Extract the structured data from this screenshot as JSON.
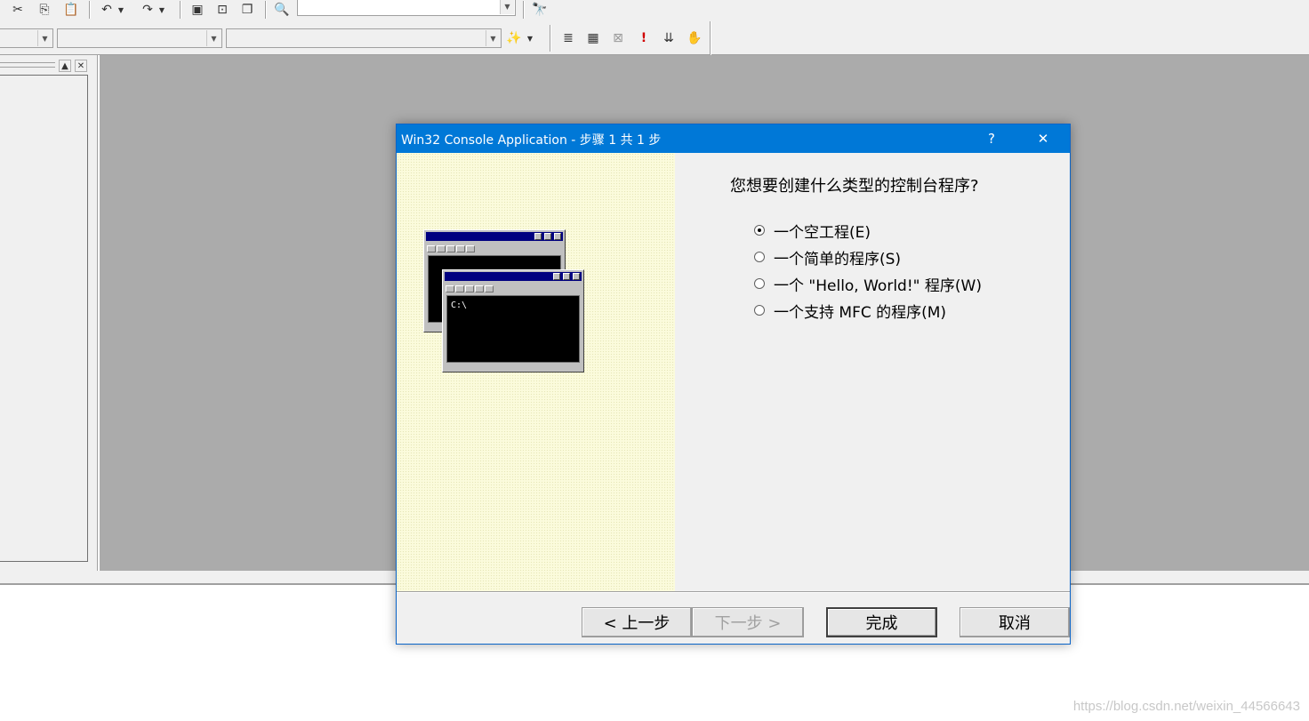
{
  "toolbar": {
    "row1_icons": [
      "cut-icon",
      "copy-icon",
      "paste-icon",
      "undo-icon",
      "redo-icon",
      "workspace-icon",
      "output-icon",
      "windows-list-icon",
      "find-in-files-icon",
      "find-icon"
    ],
    "row2_icons": [
      "wizard-icon",
      "compile-icon",
      "build-icon",
      "stop-build-icon",
      "execute-icon",
      "go-icon",
      "breakpoint-icon"
    ],
    "find_combo_value": ""
  },
  "dialog": {
    "title": "Win32 Console Application - 步骤 1 共 1 步",
    "help_label": "?",
    "close_label": "✕",
    "question": "您想要创建什么类型的控制台程序?",
    "options": [
      {
        "label": "一个空工程(E)",
        "checked": true
      },
      {
        "label": "一个简单的程序(S)",
        "checked": false
      },
      {
        "label": "一个 \"Hello, World!\" 程序(W)",
        "checked": false
      },
      {
        "label": "一个支持 MFC 的程序(M)",
        "checked": false
      }
    ],
    "illustration_prompt": "C:\\",
    "buttons": {
      "back": "< 上一步",
      "next": "下一步 >",
      "finish": "完成",
      "cancel": "取消"
    }
  },
  "watermark": "https://blog.csdn.net/weixin_44566643"
}
